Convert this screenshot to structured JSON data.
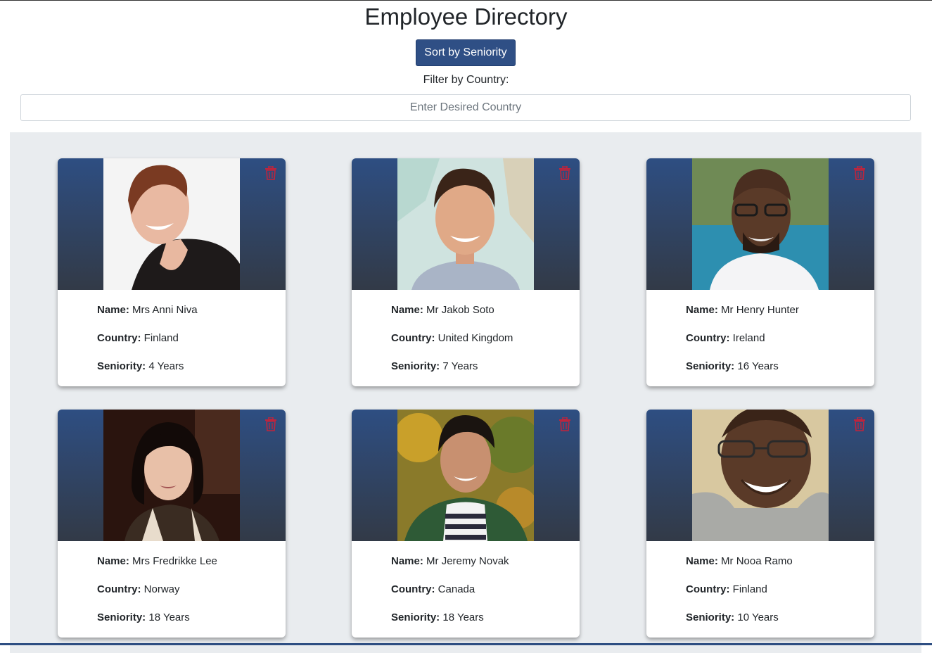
{
  "page": {
    "title": "Employee Directory",
    "sort_button_label": "Sort by Seniority",
    "filter_label": "Filter by Country:",
    "filter_placeholder": "Enter Desired Country"
  },
  "labels": {
    "name": "Name:",
    "country": "Country:",
    "seniority": "Seniority:"
  },
  "colors": {
    "button": "#2f4f85",
    "header_top": "#2e4e82",
    "header_bottom": "#323a47",
    "trash_icon": "#c0243c",
    "grid_background": "#e9ecef"
  },
  "employees": [
    {
      "name": "Mrs Anni Niva",
      "country": "Finland",
      "seniority": "4 Years",
      "photo_icon": "employee-photo"
    },
    {
      "name": "Mr Jakob Soto",
      "country": "United Kingdom",
      "seniority": "7 Years",
      "photo_icon": "employee-photo"
    },
    {
      "name": "Mr Henry Hunter",
      "country": "Ireland",
      "seniority": "16 Years",
      "photo_icon": "employee-photo"
    },
    {
      "name": "Mrs Fredrikke Lee",
      "country": "Norway",
      "seniority": "18 Years",
      "photo_icon": "employee-photo"
    },
    {
      "name": "Mr Jeremy Novak",
      "country": "Canada",
      "seniority": "18 Years",
      "photo_icon": "employee-photo"
    },
    {
      "name": "Mr Nooa Ramo",
      "country": "Finland",
      "seniority": "10 Years",
      "photo_icon": "employee-photo"
    }
  ]
}
